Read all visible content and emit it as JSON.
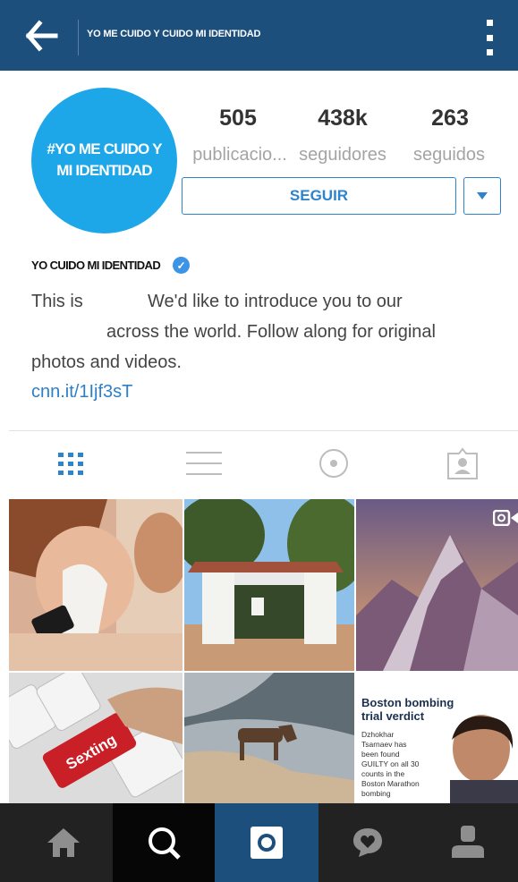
{
  "header": {
    "title": "YO ME CUIDO Y CUIDO MI IDENTIDAD",
    "back_icon": "arrow-left-icon",
    "menu_icon": "more-vertical-icon"
  },
  "profile": {
    "avatar_text": "#YO ME CUIDO Y\nMI IDENTIDAD",
    "stats": [
      {
        "value": "505",
        "label": "publicacio..."
      },
      {
        "value": "438k",
        "label": "seguidores"
      },
      {
        "value": "263",
        "label": "seguidos"
      }
    ],
    "follow_label": "SEGUIR",
    "name": "YO CUIDO MI IDENTIDAD",
    "verified_icon": "verified-badge-icon",
    "bio_line1a": "This is",
    "bio_line1b": "We'd like to introduce you to our",
    "bio_line2": "across the world. Follow along for original",
    "bio_line3": "photos and videos.",
    "link": "cnn.it/1Ijf3sT"
  },
  "tabs": [
    {
      "icon": "grid-icon",
      "active": true
    },
    {
      "icon": "list-icon",
      "active": false
    },
    {
      "icon": "location-pin-icon",
      "active": false
    },
    {
      "icon": "tagged-person-icon",
      "active": false
    }
  ],
  "posts": [
    {
      "name": "post-woman-crying-phone"
    },
    {
      "name": "post-park-gate"
    },
    {
      "name": "post-mountain-sunset",
      "video_icon": "video-camera-icon"
    },
    {
      "name": "post-sexting-keyboard",
      "key_text": "Sexting"
    },
    {
      "name": "post-dog-beach"
    },
    {
      "name": "post-boston-bombing",
      "headline": "Boston bombing trial verdict",
      "body": "Dzhokhar Tsarnaev has been found GUILTY on all 30 counts in the Boston Marathon bombing"
    }
  ],
  "bottom_nav": [
    {
      "icon": "home-icon",
      "active": false
    },
    {
      "icon": "search-icon",
      "active": true
    },
    {
      "icon": "camera-icon",
      "active": false
    },
    {
      "icon": "activity-heart-icon",
      "active": false
    },
    {
      "icon": "profile-icon",
      "active": false
    }
  ],
  "colors": {
    "header_bg": "#1d4f7c",
    "accent": "#2e84cc",
    "avatar": "#1ea7e8",
    "nav_bg": "#222222"
  }
}
